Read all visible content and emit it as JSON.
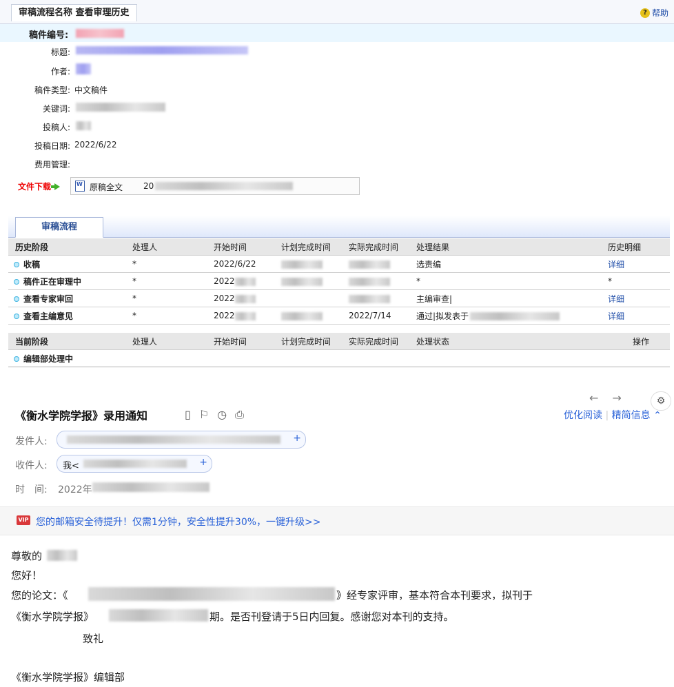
{
  "top": {
    "title": "审稿流程名称 查看审理历史",
    "help": "帮助"
  },
  "manuscript": {
    "id_label": "稿件编号:"
  },
  "fields": {
    "title_label": "标题:",
    "author_label": "作者:",
    "type_label": "稿件类型:",
    "type_value": "中文稿件",
    "keywords_label": "关键词:",
    "submitter_label": "投稿人:",
    "date_label": "投稿日期:",
    "date_value": "2022/6/22",
    "fee_label": "费用管理:"
  },
  "download": {
    "label": "文件下载",
    "file_name": "原稿全文",
    "file_date_prefix": "20"
  },
  "process": {
    "tab": "审稿流程",
    "history_headers": [
      "历史阶段",
      "处理人",
      "开始时间",
      "计划完成时间",
      "实际完成时间",
      "处理结果",
      "历史明细"
    ],
    "history_rows": [
      {
        "stage": "收稿",
        "handler": "*",
        "start": "2022/6/22",
        "plan": "",
        "actual": "",
        "result": "选责编",
        "detail": "详细"
      },
      {
        "stage": "稿件正在审理中",
        "handler": "*",
        "start": "2022",
        "plan": "",
        "actual": "",
        "result": "*",
        "detail": "*"
      },
      {
        "stage": "查看专家审回",
        "handler": "*",
        "start": "2022",
        "plan": "",
        "actual": "",
        "result": "主编审查|",
        "detail": "详细"
      },
      {
        "stage": "查看主编意见",
        "handler": "*",
        "start": "2022",
        "plan": "",
        "actual": "2022/7/14",
        "result": "通过|拟发表于",
        "detail": "详细"
      }
    ],
    "current_headers": [
      "当前阶段",
      "处理人",
      "开始时间",
      "计划完成时间",
      "实际完成时间",
      "处理状态",
      "操作"
    ],
    "current_rows": [
      {
        "stage": "编辑部处理中"
      }
    ]
  },
  "mail": {
    "subject": "《衡水学院学报》录用通知",
    "optimize": "优化阅读",
    "brief": "精简信息",
    "from_label": "发件人:",
    "to_label": "收件人:",
    "to_me": "我<",
    "time_label": "时　间:",
    "time_value": "2022年",
    "vip_badge": "VIP",
    "vip_text": "您的邮箱安全待提升！仅需1分钟，安全性提升30%，一键升级>>",
    "greeting": "尊敬的",
    "hello": "您好！",
    "paper_prefix": "您的论文：《",
    "paper_suffix": "》经专家评审，基本符合本刊要求，拟刊于",
    "journal_prefix": "《衡水学院学报》",
    "journal_suffix": "期。是否刊登请于5日内回复。感谢您对本刊的支持。",
    "regards": "致礼",
    "signature": "《衡水学院学报》编辑部"
  }
}
